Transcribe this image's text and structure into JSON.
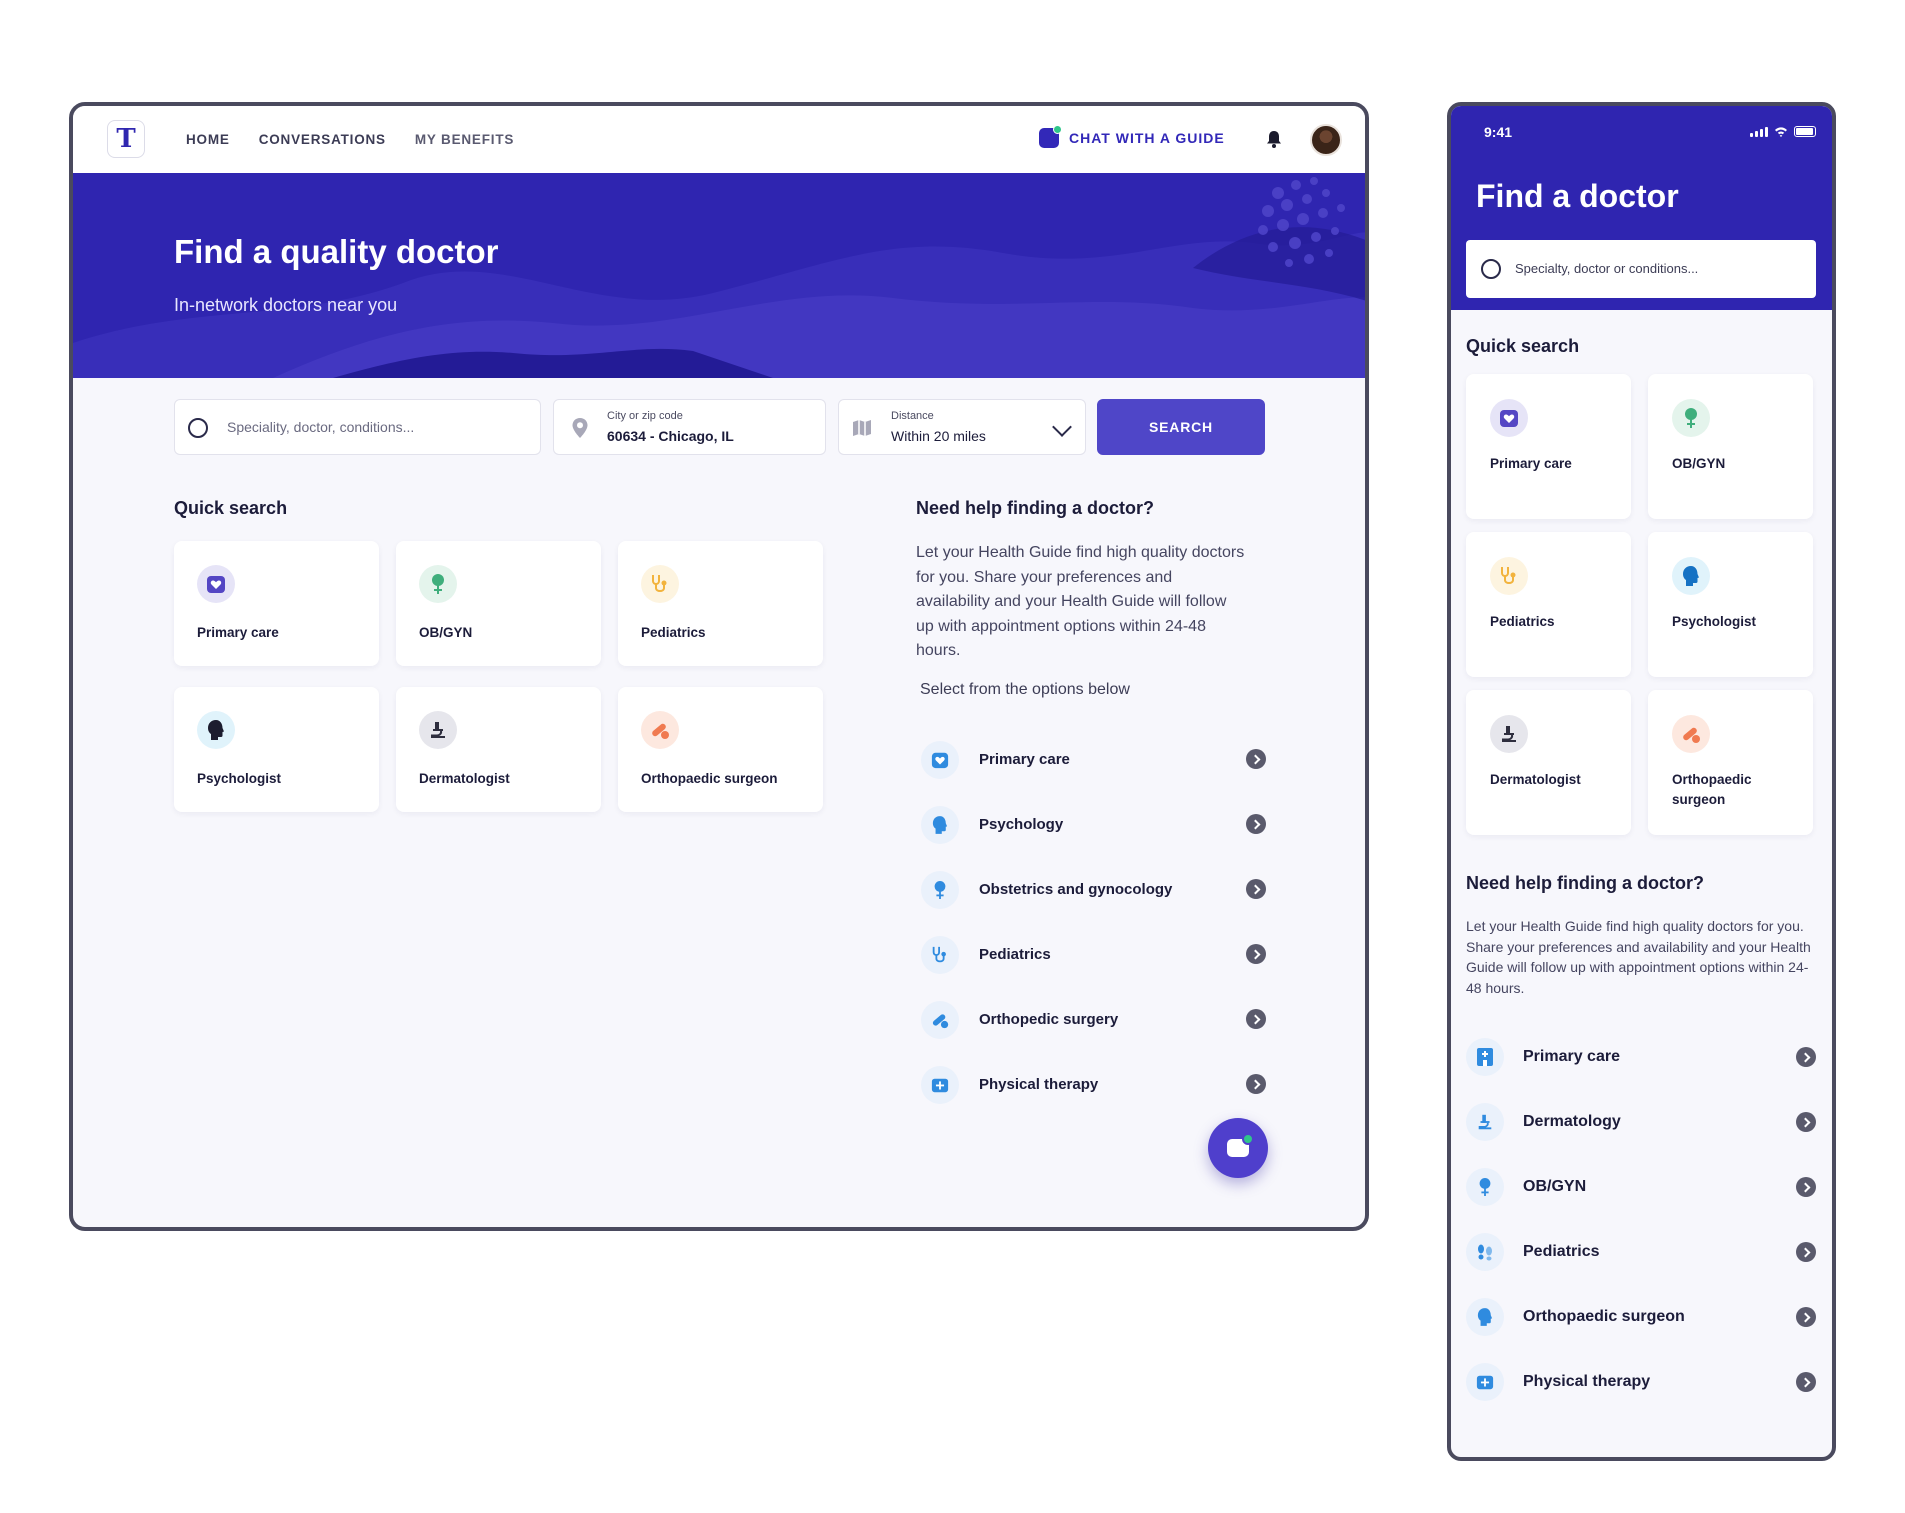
{
  "desktop": {
    "nav": {
      "logo": "T",
      "links": [
        "HOME",
        "CONVERSATIONS",
        "MY BENEFITS"
      ],
      "chat_label": "CHAT WITH A GUIDE"
    },
    "hero": {
      "title": "Find a quality doctor",
      "subtitle": "In-network doctors near you"
    },
    "search": {
      "placeholder": "Speciality, doctor, conditions...",
      "location_label": "City or zip code",
      "location_value": "60634 - Chicago, IL",
      "distance_label": "Distance",
      "distance_value": "Within 20 miles",
      "button": "SEARCH"
    },
    "quick_search": {
      "title": "Quick search",
      "items": [
        {
          "label": "Primary care",
          "icon": "heart-calendar-icon",
          "color": "#5446c4"
        },
        {
          "label": "OB/GYN",
          "icon": "female-icon",
          "color": "#3fae7c"
        },
        {
          "label": "Pediatrics",
          "icon": "stethoscope-icon",
          "color": "#f2b33d"
        },
        {
          "label": "Psychologist",
          "icon": "head-icon",
          "color": "#1c1c2e"
        },
        {
          "label": "Dermatologist",
          "icon": "microscope-icon",
          "color": "#2e2e3e"
        },
        {
          "label": "Orthopaedic surgeon",
          "icon": "bandage-icon",
          "color": "#f07a50"
        }
      ]
    },
    "help": {
      "title": "Need help finding a doctor?",
      "body": "Let your Health Guide find high quality doctors for you. Share your preferences and availability and your Health Guide will follow up with appointment options within 24-48 hours.",
      "select_text": "Select from the options below",
      "options": [
        "Primary care",
        "Psychology",
        "Obstetrics and gynocology",
        "Pediatrics",
        "Orthopedic surgery",
        "Physical therapy"
      ]
    }
  },
  "mobile": {
    "time": "9:41",
    "title": "Find a doctor",
    "search_placeholder": "Specialty, doctor or conditions...",
    "quick_search_title": "Quick search",
    "quick_items": [
      "Primary care",
      "OB/GYN",
      "Pediatrics",
      "Psychologist",
      "Dermatologist",
      "Orthopaedic surgeon"
    ],
    "help_title": "Need help finding a doctor?",
    "help_body": "Let your Health Guide find high quality doctors for you. Share your preferences and availability and your Health Guide will follow up with appointment options within 24-48 hours.",
    "options": [
      "Primary care",
      "Dermatology",
      "OB/GYN",
      "Pediatrics",
      "Orthopaedic surgeon",
      "Physical therapy"
    ]
  },
  "colors": {
    "brand": "#2f25b0",
    "button": "#4f46c8",
    "background": "#f7f7fc"
  }
}
